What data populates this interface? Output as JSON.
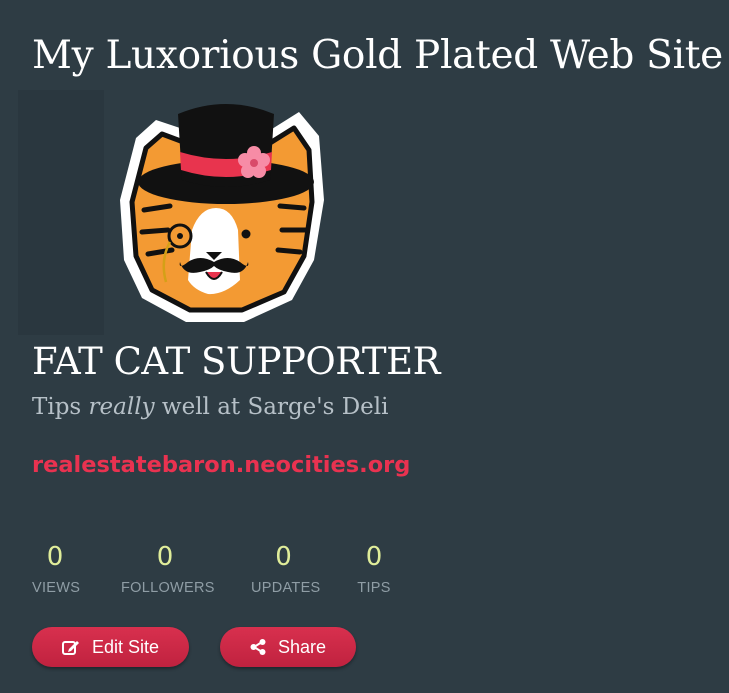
{
  "site": {
    "title": "My Luxorious Gold Plated Web Site",
    "profile_heading": "FAT CAT SUPPORTER",
    "tagline": {
      "before": "Tips ",
      "emphasis": "really",
      "after": " well at Sarge's Deli"
    },
    "url": "realestatebaron.neocities.org"
  },
  "stats": [
    {
      "value": "0",
      "label": "VIEWS"
    },
    {
      "value": "0",
      "label": "FOLLOWERS"
    },
    {
      "value": "0",
      "label": "UPDATES"
    },
    {
      "value": "0",
      "label": "TIPS"
    }
  ],
  "actions": {
    "edit_label": "Edit Site",
    "share_label": "Share"
  },
  "colors": {
    "background": "#2e3c44",
    "accent": "#e93250",
    "stat_value": "#e0ed9a",
    "stat_label": "#8f9da5",
    "tagline": "#b6c0c7"
  },
  "icons": {
    "avatar": "cat-top-hat-monocle-mustache",
    "edit": "edit-icon",
    "share": "share-icon"
  }
}
